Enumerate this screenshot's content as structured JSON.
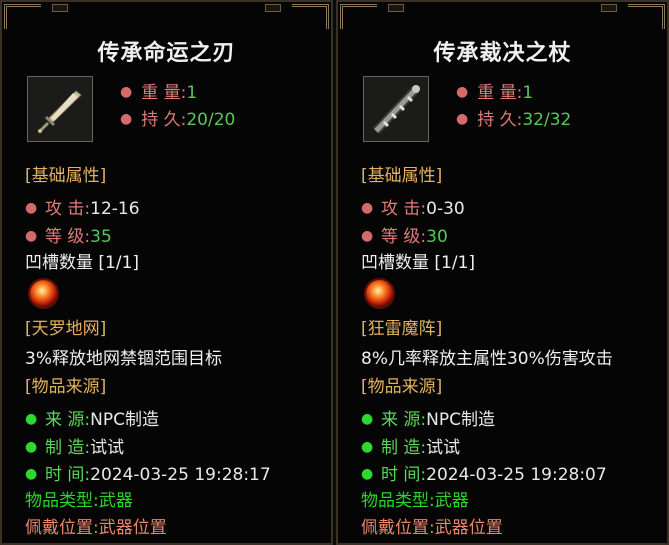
{
  "items": [
    {
      "name": "传承命运之刃",
      "weight_label": "重 量:",
      "weight": "1",
      "durability_label": "持 久:",
      "durability": "20/20",
      "base_title": "[基础属性]",
      "attack_label": "攻 击:",
      "attack": "12-16",
      "level_label": "等 级:",
      "level": "35",
      "slots": "凹槽数量 [1/1]",
      "skill_name": "[天罗地网]",
      "skill_desc": "3%释放地网禁锢范围目标",
      "source_title": "[物品来源]",
      "source_label": "来 源:",
      "source": "NPC制造",
      "maker_label": "制 造:",
      "maker": "试试",
      "time_label": "时 间:",
      "time": "2024-03-25 19:28:17",
      "type_label": "物品类型:",
      "type": "武器",
      "slot_label": "佩戴位置:",
      "slot": "武器位置"
    },
    {
      "name": "传承裁决之杖",
      "weight_label": "重 量:",
      "weight": "1",
      "durability_label": "持 久:",
      "durability": "32/32",
      "base_title": "[基础属性]",
      "attack_label": "攻 击:",
      "attack": "0-30",
      "level_label": "等 级:",
      "level": "30",
      "slots": "凹槽数量 [1/1]",
      "skill_name": "[狂雷魔阵]",
      "skill_desc": "8%几率释放主属性30%伤害攻击",
      "source_title": "[物品来源]",
      "source_label": "来 源:",
      "source": "NPC制造",
      "maker_label": "制 造:",
      "maker": "试试",
      "time_label": "时 间:",
      "time": "2024-03-25 19:28:07",
      "type_label": "物品类型:",
      "type": "武器",
      "slot_label": "佩戴位置:",
      "slot": "武器位置"
    }
  ],
  "icons": [
    "sword-icon",
    "staff-icon",
    "gem-icon"
  ],
  "colors": {
    "attr_label": "#e07b78",
    "green_value": "#56c956",
    "section_orange": "#e3b15d",
    "type_green": "#2bd62b",
    "slot_orange": "#e7876c"
  }
}
